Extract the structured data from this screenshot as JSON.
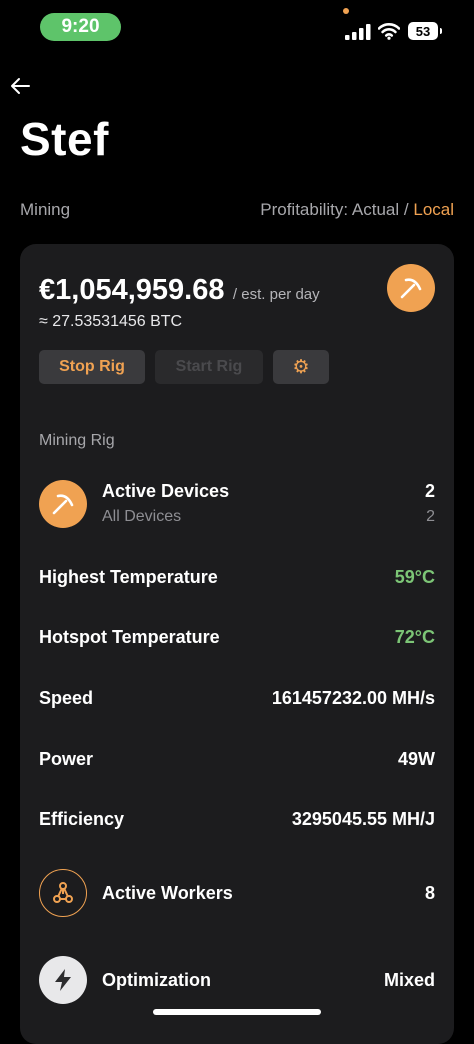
{
  "status_bar": {
    "time": "9:20",
    "battery": "53"
  },
  "header": {
    "title": "Stef"
  },
  "subheader": {
    "section": "Mining",
    "profitability_label": "Profitability:",
    "actual": "Actual",
    "separator": "/",
    "local": "Local"
  },
  "summary": {
    "amount": "€1,054,959.68",
    "per_day": "/ est. per day",
    "btc": "≈ 27.53531456 BTC"
  },
  "buttons": {
    "stop": "Stop Rig",
    "start": "Start Rig",
    "settings_icon": "gear-icon"
  },
  "rig": {
    "label": "Mining Rig",
    "active_devices": {
      "label": "Active Devices",
      "value": "2",
      "sub_label": "All Devices",
      "sub_value": "2"
    },
    "highest_temp": {
      "label": "Highest Temperature",
      "value": "59°C"
    },
    "hotspot_temp": {
      "label": "Hotspot Temperature",
      "value": "72°C"
    },
    "speed": {
      "label": "Speed",
      "value": "161457232.00 MH/s"
    },
    "power": {
      "label": "Power",
      "value": "49W"
    },
    "efficiency": {
      "label": "Efficiency",
      "value": "3295045.55 MH/J"
    },
    "active_workers": {
      "label": "Active Workers",
      "value": "8"
    },
    "optimization": {
      "label": "Optimization",
      "value": "Mixed"
    }
  },
  "colors": {
    "accent": "#f0a252",
    "good_temp": "#7cc576",
    "card": "#1c1c1e",
    "status_pill": "#5ec46a"
  }
}
